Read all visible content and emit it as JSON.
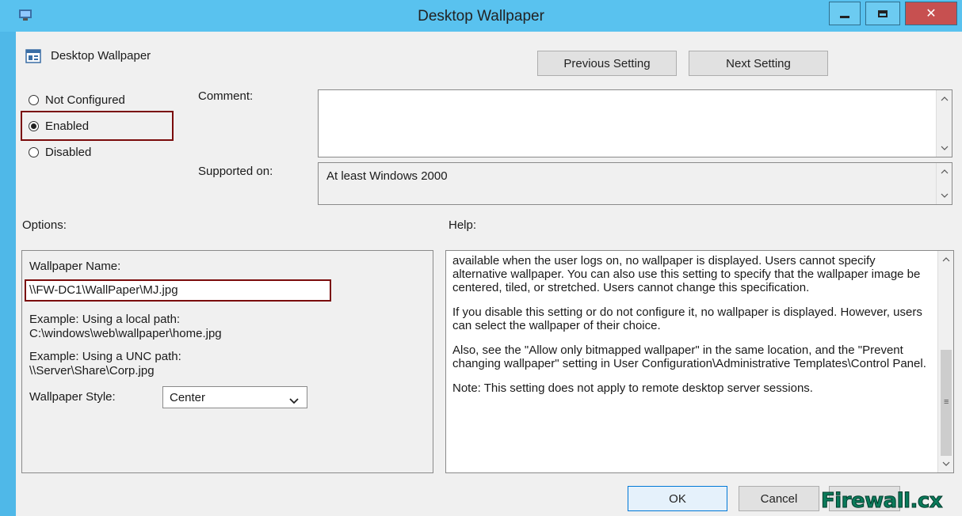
{
  "window": {
    "title": "Desktop Wallpaper",
    "controls": {
      "minimize": "—",
      "maximize": "□",
      "close": "✕"
    }
  },
  "header": {
    "policy_name": "Desktop Wallpaper",
    "previous_setting": "Previous Setting",
    "next_setting": "Next Setting"
  },
  "state": {
    "selected": "Enabled",
    "options": [
      "Not Configured",
      "Enabled",
      "Disabled"
    ]
  },
  "comment": {
    "label": "Comment:",
    "value": ""
  },
  "supported": {
    "label": "Supported on:",
    "value": "At least Windows 2000"
  },
  "options_panel": {
    "heading": "Options:",
    "wallpaper_name_label": "Wallpaper Name:",
    "wallpaper_name_value": "\\\\FW-DC1\\WallPaper\\MJ.jpg",
    "example_local_label": "Example: Using a local path:",
    "example_local_value": "C:\\windows\\web\\wallpaper\\home.jpg",
    "example_unc_label": "Example: Using a UNC path:",
    "example_unc_value": "\\\\Server\\Share\\Corp.jpg",
    "style_label": "Wallpaper Style:",
    "style_value": "Center"
  },
  "help_panel": {
    "heading": "Help:",
    "paragraphs": [
      "available when the user logs on, no wallpaper is displayed. Users cannot specify alternative wallpaper. You can also use this setting to specify that the wallpaper image be centered, tiled, or stretched. Users cannot change this specification.",
      "If you disable this setting or do not configure it, no wallpaper is displayed. However, users can select the wallpaper of their choice.",
      "Also, see the \"Allow only bitmapped wallpaper\" in the same location, and the \"Prevent changing wallpaper\" setting in User Configuration\\Administrative Templates\\Control Panel.",
      "Note: This setting does not apply to remote desktop server sessions."
    ]
  },
  "footer": {
    "ok": "OK",
    "cancel": "Cancel"
  },
  "watermark": {
    "text": "Firewall.cx"
  }
}
